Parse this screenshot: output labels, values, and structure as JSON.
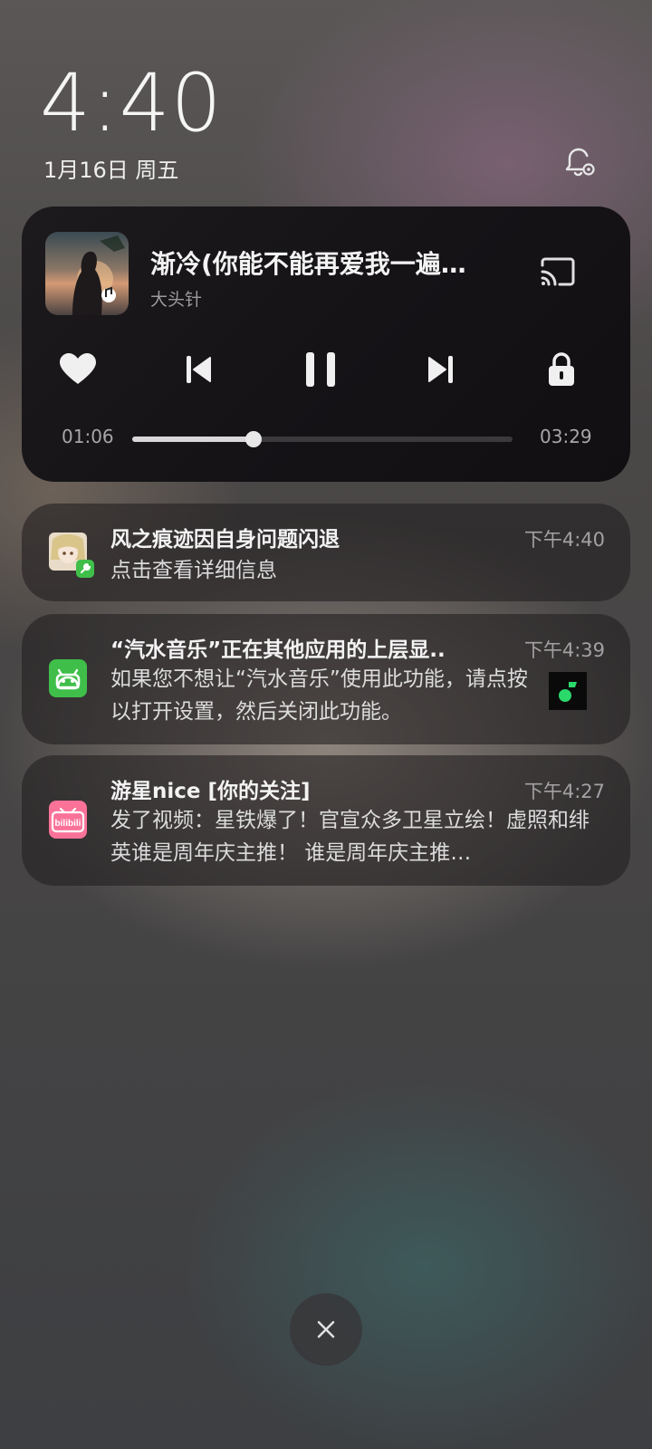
{
  "lockscreen": {
    "time": "4:40",
    "date": "1月16日 周五"
  },
  "media": {
    "title": "渐冷(你能不能再爱我一遍…",
    "artist": "大头针",
    "elapsed": "01:06",
    "duration": "03:29",
    "progress": 0.32,
    "controls": [
      "heart-icon",
      "previous-icon",
      "pause-icon",
      "next-icon",
      "lock-icon",
      "cast-icon"
    ]
  },
  "notifications": [
    {
      "icon": "game-avatar-icon",
      "title": "风之痕迹因自身问题闪退",
      "time": "下午4:40",
      "body": "点击查看详细信息"
    },
    {
      "icon": "android-robot-icon",
      "title": "“汽水音乐”正在其他应用的上层显..",
      "time": "下午4:39",
      "body": "如果您不想让“汽水音乐”使用此功能，请点按以打开设置，然后关闭此功能。",
      "thumbnail": "soda-music-icon"
    },
    {
      "icon": "bilibili-icon",
      "title": "游星nice [你的关注]",
      "time": "下午4:27",
      "body": "发了视频：星铁爆了！官宣众多卫星立绘！虚照和绯英谁是周年庆主推！ 谁是周年庆主推…"
    }
  ],
  "colors": {
    "android_green": "#3fbf4a",
    "bilibili_pink": "#fb7299",
    "soda_green": "#2bd96b"
  }
}
